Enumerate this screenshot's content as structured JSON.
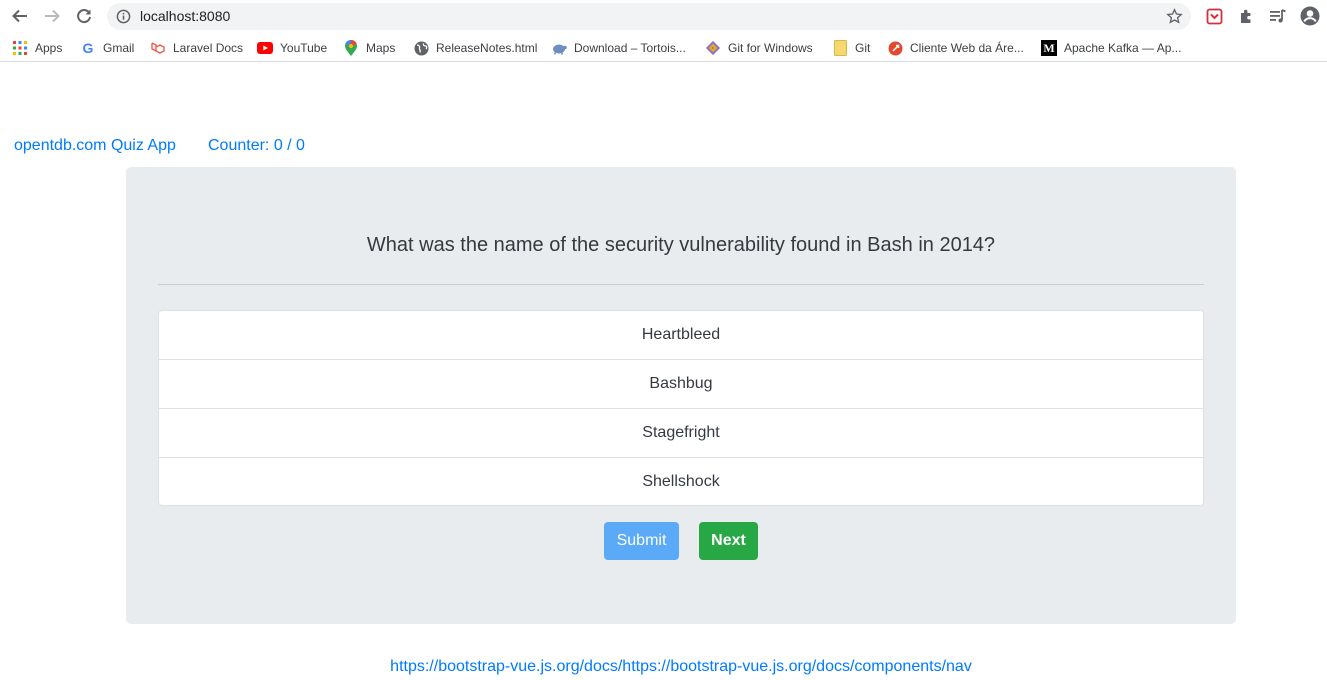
{
  "browser": {
    "url": "localhost:8080",
    "bookmarks": [
      {
        "label": "Apps",
        "icon": "apps-grid-icon"
      },
      {
        "label": "Gmail",
        "icon": "google-icon"
      },
      {
        "label": "Laravel Docs",
        "icon": "laravel-icon"
      },
      {
        "label": "YouTube",
        "icon": "youtube-icon"
      },
      {
        "label": "Maps",
        "icon": "maps-pin-icon"
      },
      {
        "label": "ReleaseNotes.html",
        "icon": "globe-icon"
      },
      {
        "label": "Download – Tortois...",
        "icon": "tortoise-icon"
      },
      {
        "label": "Git for Windows",
        "icon": "git-diamond-icon"
      },
      {
        "label": "Git",
        "icon": "folder-icon"
      },
      {
        "label": "Cliente Web da Áre...",
        "icon": "rocket-icon"
      },
      {
        "label": "Apache Kafka — Ap...",
        "icon": "medium-icon"
      }
    ]
  },
  "app": {
    "brand": "opentdb.com Quiz App",
    "counter": "Counter: 0 / 0"
  },
  "quiz": {
    "question": "What was the name of the security vulnerability found in Bash in 2014?",
    "answers": [
      "Heartbleed",
      "Bashbug",
      "Stagefright",
      "Shellshock"
    ],
    "submit_label": "Submit",
    "next_label": "Next"
  },
  "footer": {
    "link": "https://bootstrap-vue.js.org/docs/https://bootstrap-vue.js.org/docs/components/nav"
  }
}
